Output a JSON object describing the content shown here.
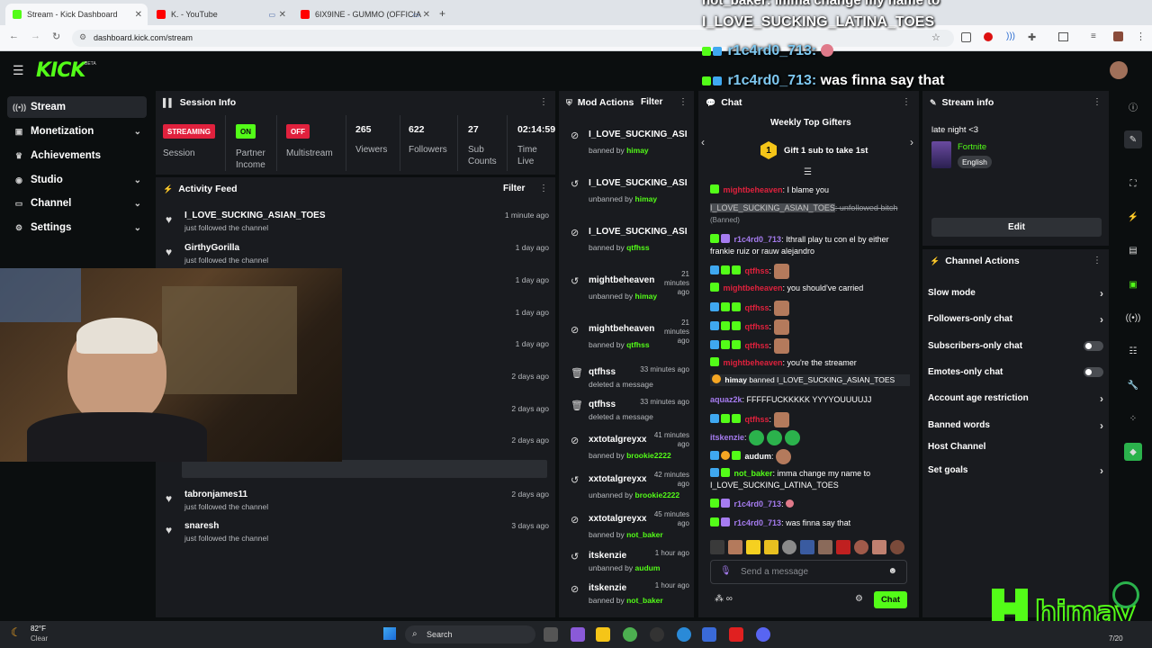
{
  "browser": {
    "tabs": [
      {
        "label": "Stream - Kick Dashboard",
        "color": "#53fc18"
      },
      {
        "label": "K. - YouTube",
        "color": "#ff0000"
      },
      {
        "label": "6IX9INE - GUMMO (OFFICIA",
        "color": "#ff0000"
      }
    ],
    "url": "dashboard.kick.com/stream"
  },
  "logo": {
    "text": "KICK",
    "beta": "BETA"
  },
  "sidebar": {
    "items": [
      {
        "label": "Stream"
      },
      {
        "label": "Monetization"
      },
      {
        "label": "Achievements"
      },
      {
        "label": "Studio"
      },
      {
        "label": "Channel"
      },
      {
        "label": "Settings"
      }
    ]
  },
  "session": {
    "title": "Session Info",
    "status_badge": "STREAMING",
    "status_label": "Session",
    "partner_badge": "ON",
    "partner_label": "Partner Income",
    "multistream_badge": "OFF",
    "multistream_label": "Multistream",
    "viewers": "265",
    "viewers_label": "Viewers",
    "followers": "622",
    "followers_label": "Followers",
    "subs": "27",
    "subs_label": "Sub Counts",
    "time": "02:14:59",
    "time_label": "Time Live"
  },
  "activity": {
    "title": "Activity Feed",
    "filter": "Filter",
    "rows": [
      {
        "name": "I_LOVE_SUCKING_ASIAN_TOES",
        "sub": "just followed the channel",
        "time": "1 minute ago"
      },
      {
        "name": "GirthyGorilla",
        "sub": "just followed the channel",
        "time": "1 day ago"
      },
      {
        "name": "",
        "sub": "",
        "time": "1 day ago"
      },
      {
        "name": "",
        "sub": "",
        "time": "1 day ago"
      },
      {
        "name": "",
        "sub": "",
        "time": "1 day ago"
      },
      {
        "name": "",
        "sub": "",
        "time": "2 days ago"
      },
      {
        "name": "",
        "sub": "",
        "time": "2 days ago"
      },
      {
        "name": "",
        "sub": "",
        "time": "2 days ago"
      },
      {
        "name": "tabronjames11",
        "sub": "just followed the channel",
        "time": "2 days ago"
      },
      {
        "name": "snaresh",
        "sub": "just followed the channel",
        "time": "3 days ago"
      }
    ]
  },
  "mod": {
    "title": "Mod Actions",
    "filter": "Filter",
    "rows": [
      {
        "icon": "ban",
        "name": "I_LOVE_SUCKING_ASIAN_TOES",
        "action": "banned by ",
        "by": "himay",
        "time": ""
      },
      {
        "icon": "unban",
        "name": "I_LOVE_SUCKING_ASIAN_TOES",
        "action": "unbanned by ",
        "by": "himay",
        "time": ""
      },
      {
        "icon": "ban",
        "name": "I_LOVE_SUCKING_ASIAN_TOES",
        "action": "banned by ",
        "by": "qtfhss",
        "time": ""
      },
      {
        "icon": "unban",
        "name": "mightbeheaven",
        "action": "unbanned by ",
        "by": "himay",
        "time": "21 minutes ago"
      },
      {
        "icon": "ban",
        "name": "mightbeheaven",
        "action": "banned by ",
        "by": "qtfhss",
        "time": "21 minutes ago"
      },
      {
        "icon": "trash",
        "name": "qtfhss",
        "action": "deleted a message",
        "by": "",
        "time": "33 minutes ago"
      },
      {
        "icon": "trash",
        "name": "qtfhss",
        "action": "deleted a message",
        "by": "",
        "time": "33 minutes ago"
      },
      {
        "icon": "ban",
        "name": "xxtotalgreyxx",
        "action": "banned by ",
        "by": "brookie2222",
        "time": "41 minutes ago"
      },
      {
        "icon": "unban",
        "name": "xxtotalgreyxx",
        "action": "unbanned by ",
        "by": "brookie2222",
        "time": "42 minutes ago"
      },
      {
        "icon": "ban",
        "name": "xxtotalgreyxx",
        "action": "banned by ",
        "by": "not_baker",
        "time": "45 minutes ago"
      },
      {
        "icon": "unban",
        "name": "itskenzie",
        "action": "unbanned by ",
        "by": "audum",
        "time": "1 hour ago"
      },
      {
        "icon": "ban",
        "name": "itskenzie",
        "action": "banned by ",
        "by": "not_baker",
        "time": "1 hour ago"
      }
    ]
  },
  "chat": {
    "title": "Chat",
    "gifters_title": "Weekly Top Gifters",
    "gift_rank": "1",
    "gift_text": "Gift 1 sub to take 1st",
    "placeholder": "Send a message",
    "send": "Chat",
    "messages": {
      "m1_user": "mightbeheaven",
      "m1_text": ": I blame you",
      "m2_user": "I_LOVE_SUCKING_ASIAN_TOES",
      "m2_text": ": unfollowed bitch",
      "m2_tag": "(Banned)",
      "m3_user": "r1c4rd0_713",
      "m3_text": ": Ithrall play tu con el by either frankie ruiz or rauw alejandro",
      "m4_user": "qtfhss",
      "m5_user": "mightbeheaven",
      "m5_text": ": you should've carried",
      "m6_user": "qtfhss",
      "m7_user": "qtfhss",
      "m8_user": "qtfhss",
      "m9_user": "mightbeheaven",
      "m9_text": ": you're the streamer",
      "m10_user": "himay",
      "m10_text": " banned I_LOVE_SUCKING_ASIAN_TOES",
      "m11_user": "aquaz2k",
      "m11_text": ": FFFFFUCKKKKK YYYYOUUUUJJ",
      "m12_user": "qtfhss",
      "m13_user": "itskenzie",
      "m14_user": "audum",
      "m15_user": "not_baker",
      "m15_text": ": imma change my name to I_LOVE_SUCKING_LATINA_TOES",
      "m16_user": "r1c4rd0_713",
      "m17_user": "r1c4rd0_713",
      "m17_text": ": was finna say that"
    }
  },
  "streaminfo": {
    "title": "Stream info",
    "stream_title": "late night <3",
    "category": "Fortnite",
    "language": "English",
    "edit": "Edit"
  },
  "channel_actions": {
    "title": "Channel Actions",
    "items": [
      {
        "label": "Slow mode"
      },
      {
        "label": "Followers-only chat"
      },
      {
        "label": "Subscribers-only chat"
      },
      {
        "label": "Emotes-only chat"
      },
      {
        "label": "Account age restriction"
      },
      {
        "label": "Banned words"
      },
      {
        "label": "Host Channel"
      },
      {
        "label": "Set goals"
      }
    ]
  },
  "overlay": {
    "line1": "not_baker: imma change my name to",
    "line2": "I_LOVE_SUCKING_LATINA_TOES",
    "line3_user": "r1c4rd0_713:",
    "line4_user": "r1c4rd0_713:",
    "line4_text": "was finna say that",
    "brand": "himay"
  },
  "taskbar": {
    "temp": "82°F",
    "weather": "Clear",
    "search": "Search",
    "date": "7/20"
  },
  "colors": {
    "kick_green": "#53fc18",
    "panel": "#191b1f",
    "red_badge": "#e0213d"
  }
}
